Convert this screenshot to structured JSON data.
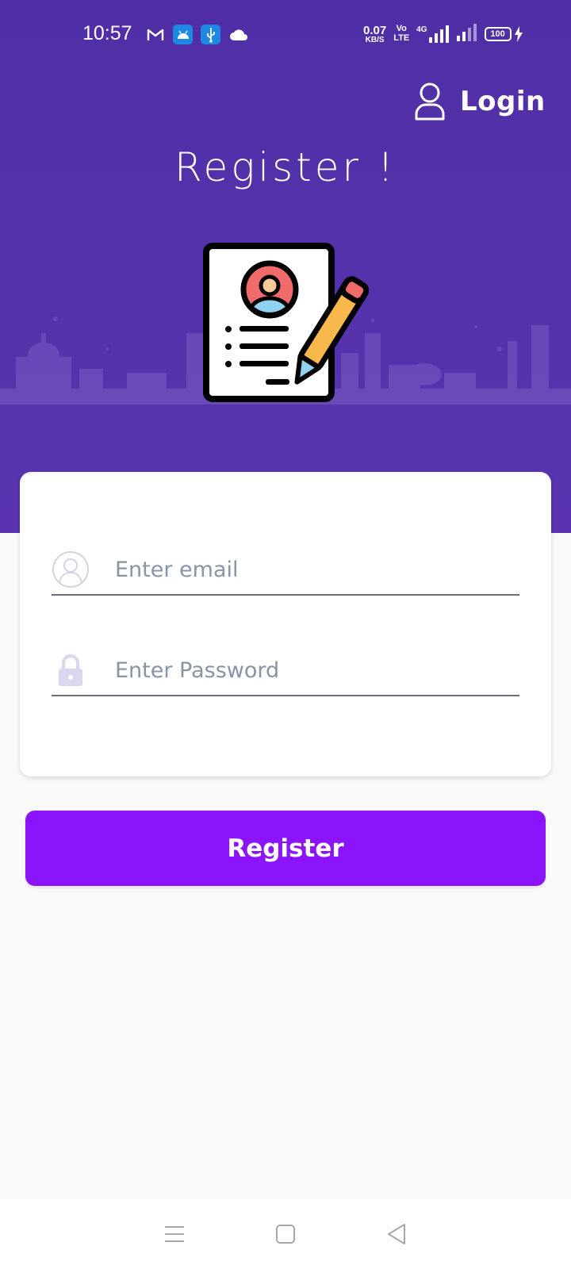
{
  "status_bar": {
    "time": "10:57",
    "icons_left": [
      "gmail-icon",
      "android-icon",
      "usb-icon",
      "cloud-icon"
    ],
    "net_speed_value": "0.07",
    "net_speed_unit": "KB/S",
    "volte_top": "Vo",
    "volte_bottom": "LTE",
    "network_type": "4G",
    "battery": "100"
  },
  "header": {
    "login_label": "Login",
    "title": "Register !",
    "colors": {
      "background": "#5533ac",
      "text": "#ffffff"
    }
  },
  "form": {
    "email_placeholder": "Enter email",
    "password_placeholder": "Enter Password"
  },
  "actions": {
    "register_label": "Register",
    "color": "#8c14fb"
  },
  "nav": {
    "items": [
      "menu-icon",
      "home-icon",
      "back-icon"
    ]
  }
}
